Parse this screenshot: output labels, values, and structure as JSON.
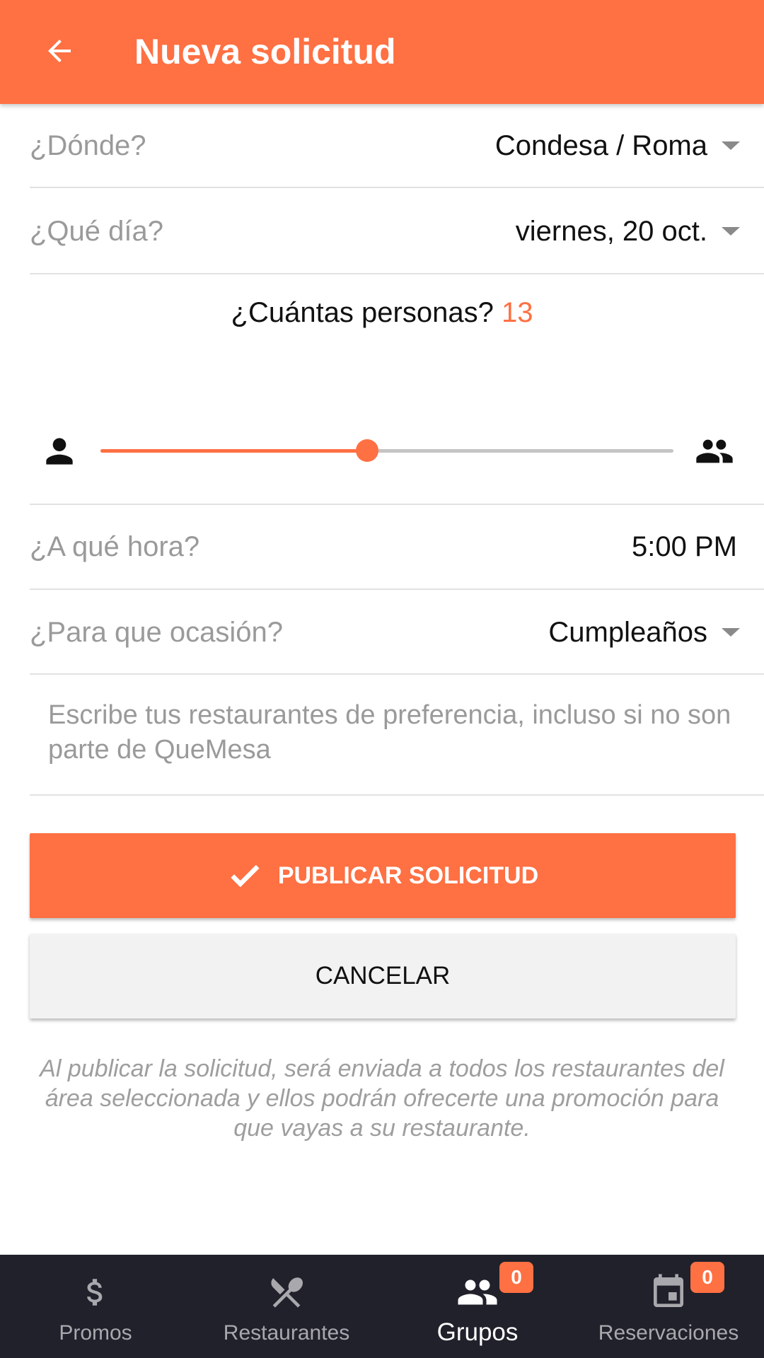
{
  "header": {
    "title": "Nueva solicitud"
  },
  "form": {
    "location": {
      "label": "¿Dónde?",
      "value": "Condesa / Roma"
    },
    "day": {
      "label": "¿Qué día?",
      "value": "viernes, 20 oct."
    },
    "people": {
      "label": "¿Cuántas personas?",
      "value": "13",
      "slider_fraction": 0.465
    },
    "time": {
      "label": "¿A qué hora?",
      "value": "5:00 PM"
    },
    "occasion": {
      "label": "¿Para que ocasión?",
      "value": "Cumpleaños"
    },
    "notes": {
      "placeholder": "Escribe tus restaurantes de preferencia, incluso si no son parte de QueMesa",
      "value": ""
    }
  },
  "actions": {
    "publish_label": "PUBLICAR SOLICITUD",
    "cancel_label": "CANCELAR"
  },
  "disclaimer": "Al publicar la solicitud, será enviada a todos los restaurantes del área seleccionada y ellos podrán ofrecerte una promoción para que vayas a su restaurante.",
  "bottom_nav": {
    "items": [
      {
        "label": "Promos",
        "icon": "dollar-icon"
      },
      {
        "label": "Restaurantes",
        "icon": "utensils-icon"
      },
      {
        "label": "Grupos",
        "icon": "group-icon",
        "badge": "0",
        "active": true
      },
      {
        "label": "Reservaciones",
        "icon": "calendar-icon",
        "badge": "0"
      }
    ]
  },
  "colors": {
    "accent": "#ff7043",
    "nav_background": "#20212b"
  }
}
